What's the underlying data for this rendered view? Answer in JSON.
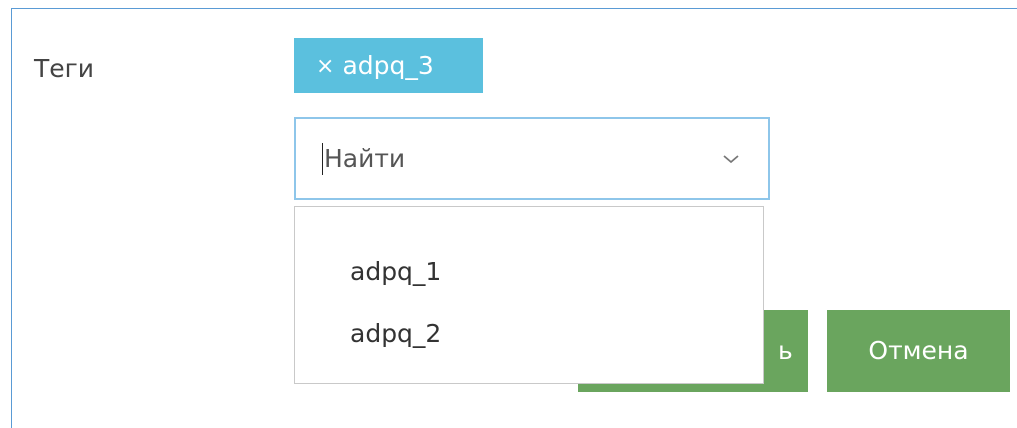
{
  "form": {
    "tags_label": "Теги",
    "selected_tags": [
      {
        "label": "adpq_3",
        "remove_symbol": "×"
      }
    ],
    "search": {
      "value": "",
      "placeholder": "Найти",
      "icon": "chevron-down-icon"
    },
    "dropdown": {
      "options": [
        {
          "label": "adpq_1"
        },
        {
          "label": "adpq_2"
        }
      ]
    },
    "actions": {
      "save_label_partial": "ь",
      "cancel_label": "Отмена"
    }
  },
  "colors": {
    "panel_border": "#5a9bd5",
    "tag_bg": "#5bc0de",
    "input_focus_border": "#8ec6ea",
    "button_bg": "#6aa55e",
    "dropdown_border": "#c9c9c9"
  }
}
